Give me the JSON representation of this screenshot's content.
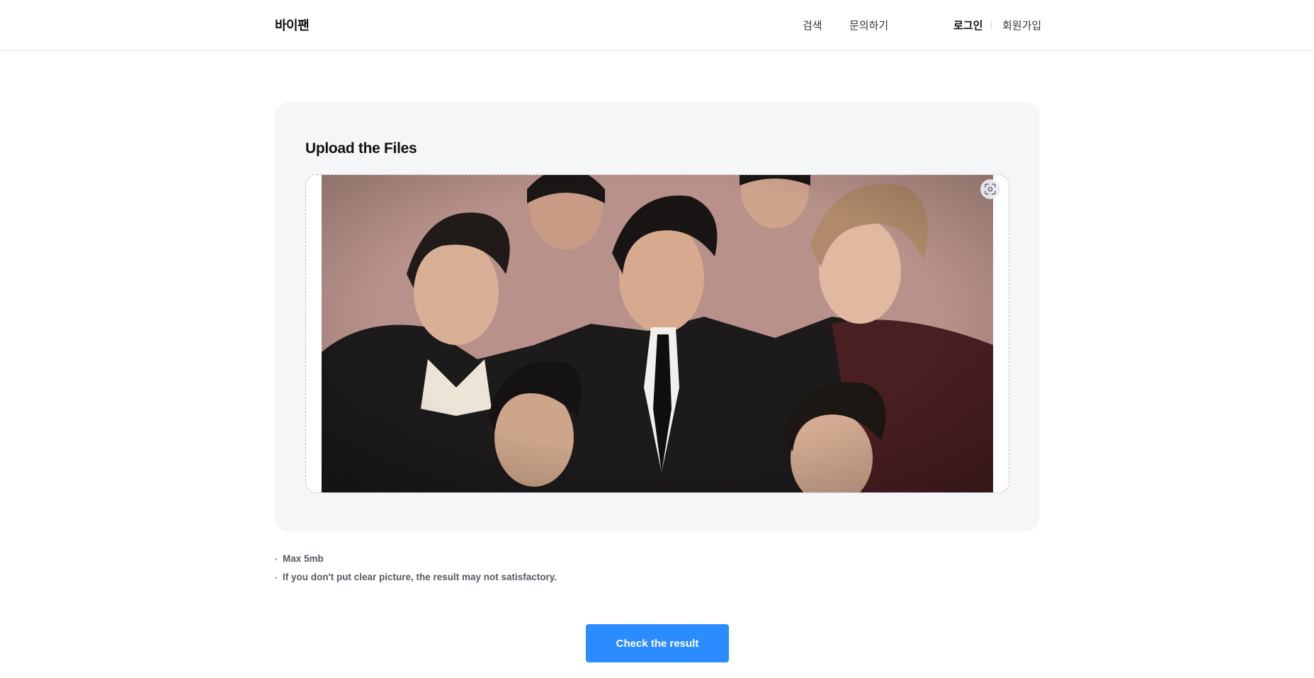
{
  "header": {
    "logo": "바이팬",
    "nav": {
      "search": "검색",
      "inquiry": "문의하기",
      "login": "로그인",
      "signup": "회원가입"
    }
  },
  "upload": {
    "title": "Upload the Files",
    "scan_icon": "scan-icon"
  },
  "notes": [
    "Max 5mb",
    "If you don't put clear picture, the result may not satisfactory."
  ],
  "cta": {
    "label": "Check the result",
    "color": "#2b8cff"
  }
}
